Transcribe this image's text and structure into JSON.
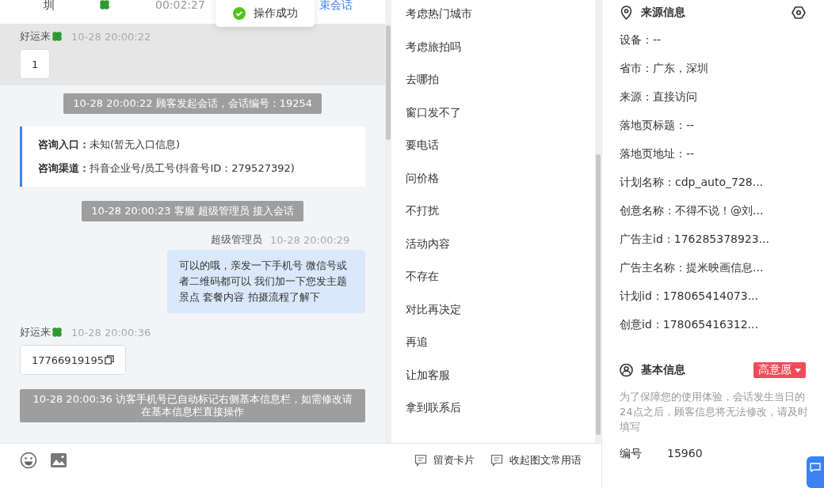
{
  "header": {
    "city": "圳",
    "duration": "00:02:27",
    "end_button": "束会话"
  },
  "toast": {
    "text": "操作成功"
  },
  "messages": [
    {
      "kind": "visitor",
      "name": "好运来",
      "time": "10-28 20:00:22",
      "text": "1",
      "highlighted": true
    },
    {
      "kind": "system",
      "text": "10-28 20:00:22 顾客发起会话，会话编号：19254"
    },
    {
      "kind": "card",
      "rows": [
        {
          "label": "咨询入口：",
          "value": "未知(暂无入口信息)"
        },
        {
          "label": "咨询渠道：",
          "value": "抖音企业号/员工号(抖音号ID：279527392)"
        }
      ]
    },
    {
      "kind": "system",
      "text": "10-28 20:00:23 客服 超级管理员 接入会话"
    },
    {
      "kind": "agent",
      "name": "超级管理员",
      "time": "10-28 20:00:29",
      "text": "可以的哦，亲发一下手机号 微信号或者二维码都可以 我们加一下您发主题景点 套餐内容 拍摄流程了解下"
    },
    {
      "kind": "visitor",
      "name": "好运来",
      "time": "10-28 20:00:36",
      "text": "17766919195",
      "copyable": true,
      "highlighted": false
    },
    {
      "kind": "system",
      "text": "10-28 20:00:36 访客手机号已自动标记右侧基本信息栏，如需修改请在基本信息栏直接操作"
    }
  ],
  "toolbar": {
    "buttons": [
      "留资卡片",
      "收起图文常用语"
    ]
  },
  "quick_replies": [
    "考虑热门城市",
    "考虑旅拍吗",
    "去哪拍",
    "窗口发不了",
    "要电话",
    "问价格",
    "不打扰",
    "活动内容",
    "不存在",
    "对比再决定",
    "再追",
    "让加客服",
    "拿到联系后"
  ],
  "source_info": {
    "title": "来源信息",
    "fields": [
      "设备：--",
      "省市：广东，深圳",
      "来源：直接访问",
      "落地页标题：--",
      "落地页地址：--",
      "计划名称：cdp_auto_728...",
      "创意名称：不得不说！@刘...",
      "广告主id：176285378923...",
      "广告主名称：提米映画信息...",
      "计划id：178065414073...",
      "创意id：178065416312..."
    ]
  },
  "basic_info": {
    "title": "基本信息",
    "intent_tag": "高意愿",
    "note": "为了保障您的使用体验，会话发生当日的24点之后，顾客信息将无法修改，请及时填写",
    "fields": [
      {
        "label": "编号",
        "value": "15960"
      }
    ]
  }
}
